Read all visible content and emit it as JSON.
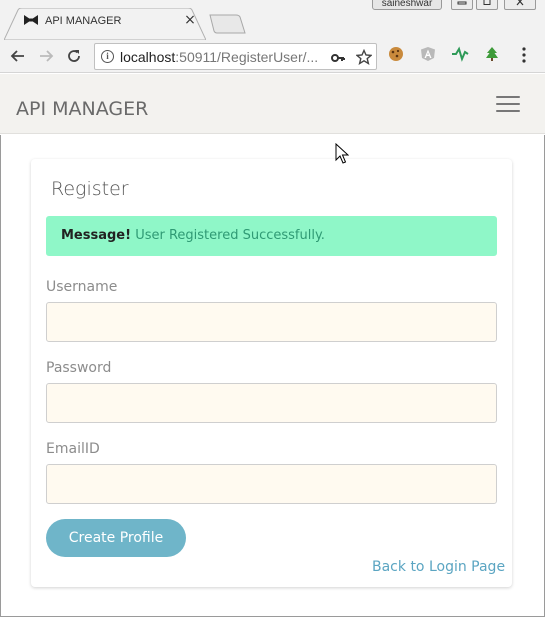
{
  "browser": {
    "tab_title": "API MANAGER",
    "tab_favicon": "bowtie-icon",
    "tab_close": "×",
    "user_name": "saineshwar",
    "url_host": "localhost",
    "url_rest": ":50911/RegisterUser/...",
    "icons": {
      "back": "arrow-left-icon",
      "forward": "arrow-right-icon",
      "reload": "reload-icon",
      "info": "info-icon",
      "key": "key-icon",
      "star": "star-icon",
      "menu": "three-dots-icon"
    }
  },
  "navbar": {
    "brand": "API MANAGER",
    "menu_icon": "hamburger-icon"
  },
  "form": {
    "title": "Register",
    "alert": {
      "prefix": "Message!",
      "text": "User Registered Successfully."
    },
    "fields": [
      {
        "label": "Username",
        "value": "",
        "placeholder": ""
      },
      {
        "label": "Password",
        "value": "",
        "placeholder": ""
      },
      {
        "label": "EmailID",
        "value": "",
        "placeholder": ""
      }
    ],
    "submit_label": "Create Profile",
    "back_link": "Back to Login Page"
  },
  "colors": {
    "navbar_bg": "#f3f2ef",
    "alert_bg": "#8ff7c8",
    "alert_text": "#2f9a74",
    "button_bg": "#6fb5c9",
    "link": "#5ba5c2",
    "input_bg": "#fffaf0"
  }
}
